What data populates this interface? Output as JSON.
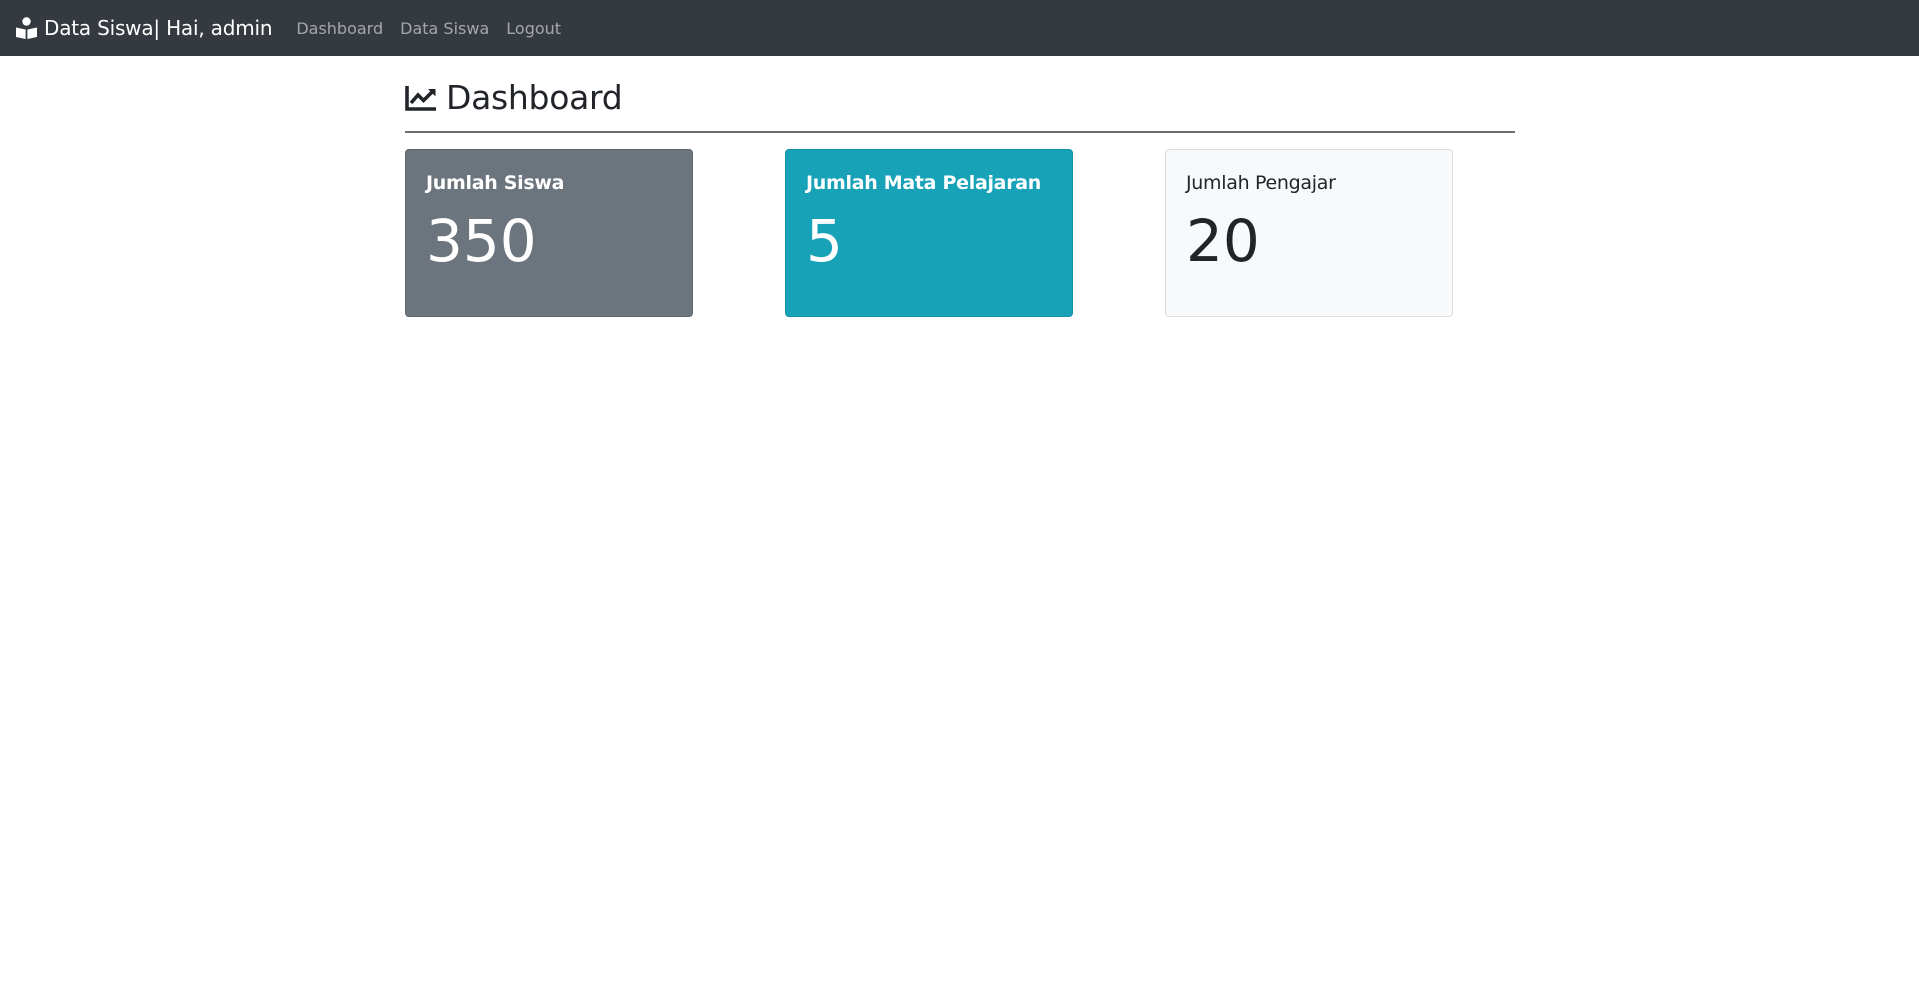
{
  "navbar": {
    "brand": "Data Siswa| Hai, admin",
    "brand_icon": "book-reader-icon",
    "links": [
      {
        "label": "Dashboard"
      },
      {
        "label": "Data Siswa"
      },
      {
        "label": "Logout"
      }
    ]
  },
  "main": {
    "title": "Dashboard",
    "title_icon": "chart-line-icon",
    "cards": [
      {
        "title": "Jumlah Siswa",
        "value": "350",
        "color": "#6c757d"
      },
      {
        "title": "Jumlah Mata Pelajaran",
        "value": "5",
        "color": "#17a2b8"
      },
      {
        "title": "Jumlah Pengajar",
        "value": "20",
        "color": "#f8f9fa"
      }
    ]
  }
}
